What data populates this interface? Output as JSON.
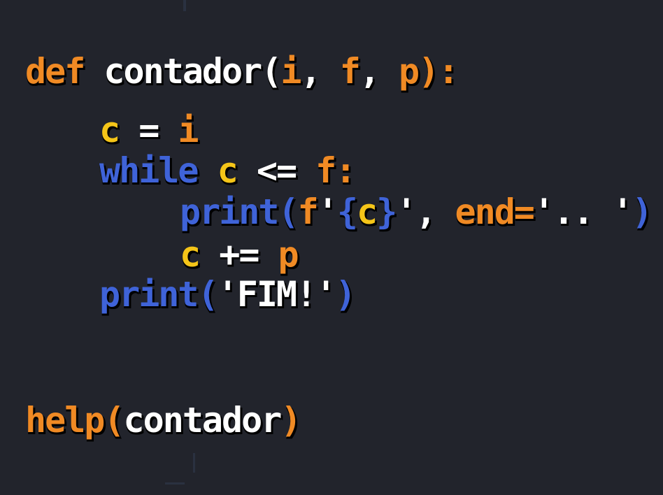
{
  "colors": {
    "background": "#22242c",
    "keyword": "#f08a24",
    "identifier": "#ffffff",
    "variable": "#f5c518",
    "builtin": "#3f63d8",
    "shadow": "#000000"
  },
  "code_lines": [
    [
      {
        "text": "def ",
        "role": "keyword"
      },
      {
        "text": "contador(",
        "role": "identifier"
      },
      {
        "text": "i",
        "role": "keyword"
      },
      {
        "text": ", ",
        "role": "identifier"
      },
      {
        "text": "f",
        "role": "keyword"
      },
      {
        "text": ", ",
        "role": "identifier"
      },
      {
        "text": "p",
        "role": "keyword"
      },
      {
        "text": "):",
        "role": "keyword"
      }
    ],
    [
      {
        "text": "c",
        "role": "variable"
      },
      {
        "text": " = ",
        "role": "identifier"
      },
      {
        "text": "i",
        "role": "keyword"
      }
    ],
    [
      {
        "text": "while ",
        "role": "builtin"
      },
      {
        "text": "c",
        "role": "variable"
      },
      {
        "text": " <= ",
        "role": "identifier"
      },
      {
        "text": "f",
        "role": "keyword"
      },
      {
        "text": ":",
        "role": "keyword"
      }
    ],
    [
      {
        "text": "print(",
        "role": "builtin"
      },
      {
        "text": "f",
        "role": "keyword"
      },
      {
        "text": "'",
        "role": "identifier"
      },
      {
        "text": "{",
        "role": "builtin"
      },
      {
        "text": "c",
        "role": "variable"
      },
      {
        "text": "}",
        "role": "builtin"
      },
      {
        "text": "', ",
        "role": "identifier"
      },
      {
        "text": "end",
        "role": "keyword"
      },
      {
        "text": "=",
        "role": "keyword"
      },
      {
        "text": "'.. '",
        "role": "identifier"
      },
      {
        "text": ")",
        "role": "builtin"
      }
    ],
    [
      {
        "text": "c",
        "role": "variable"
      },
      {
        "text": " += ",
        "role": "identifier"
      },
      {
        "text": "p",
        "role": "keyword"
      }
    ],
    [
      {
        "text": "print(",
        "role": "builtin"
      },
      {
        "text": "'FIM!'",
        "role": "identifier"
      },
      {
        "text": ")",
        "role": "builtin"
      }
    ],
    [
      {
        "text": "help(",
        "role": "keyword"
      },
      {
        "text": "contador",
        "role": "identifier"
      },
      {
        "text": ")",
        "role": "keyword"
      }
    ]
  ]
}
